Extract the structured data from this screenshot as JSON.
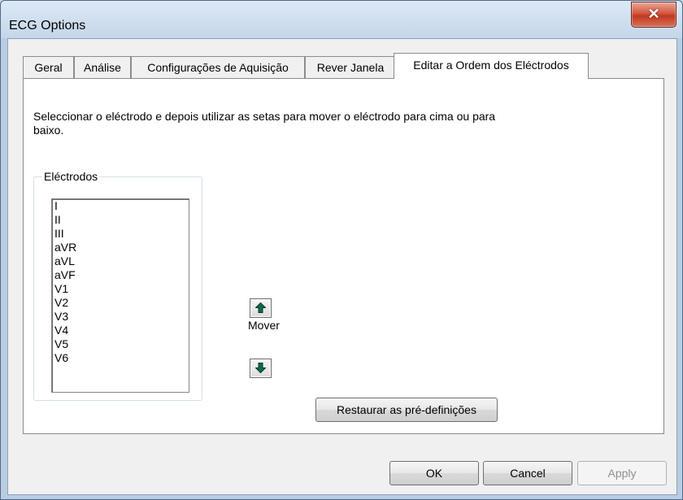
{
  "window": {
    "title": "ECG Options",
    "close_glyph": "✕"
  },
  "tabs": [
    {
      "label": "Geral",
      "active": false
    },
    {
      "label": "Análise",
      "active": false
    },
    {
      "label": "Configurações de Aquisição",
      "active": false
    },
    {
      "label": "Rever Janela",
      "active": false
    },
    {
      "label": "Editar a Ordem dos Eléctrodos",
      "active": true
    }
  ],
  "panel": {
    "instructions": "Seleccionar o eléctrodo e depois utilizar as setas para mover o eléctrodo para cima ou para baixo.",
    "group_label": "Eléctrodos",
    "electrodes": [
      "I",
      "II",
      "III",
      "aVR",
      "aVL",
      "aVF",
      "V1",
      "V2",
      "V3",
      "V4",
      "V5",
      "V6"
    ],
    "move_label": "Mover",
    "move_up_icon": "arrow-up-icon",
    "move_down_icon": "arrow-down-icon",
    "restore_label": "Restaurar as pré-definições"
  },
  "footer": {
    "ok_label": "OK",
    "cancel_label": "Cancel",
    "apply_label": "Apply"
  },
  "colors": {
    "arrow": "#0f6b48",
    "close_button": "#c0391f"
  }
}
